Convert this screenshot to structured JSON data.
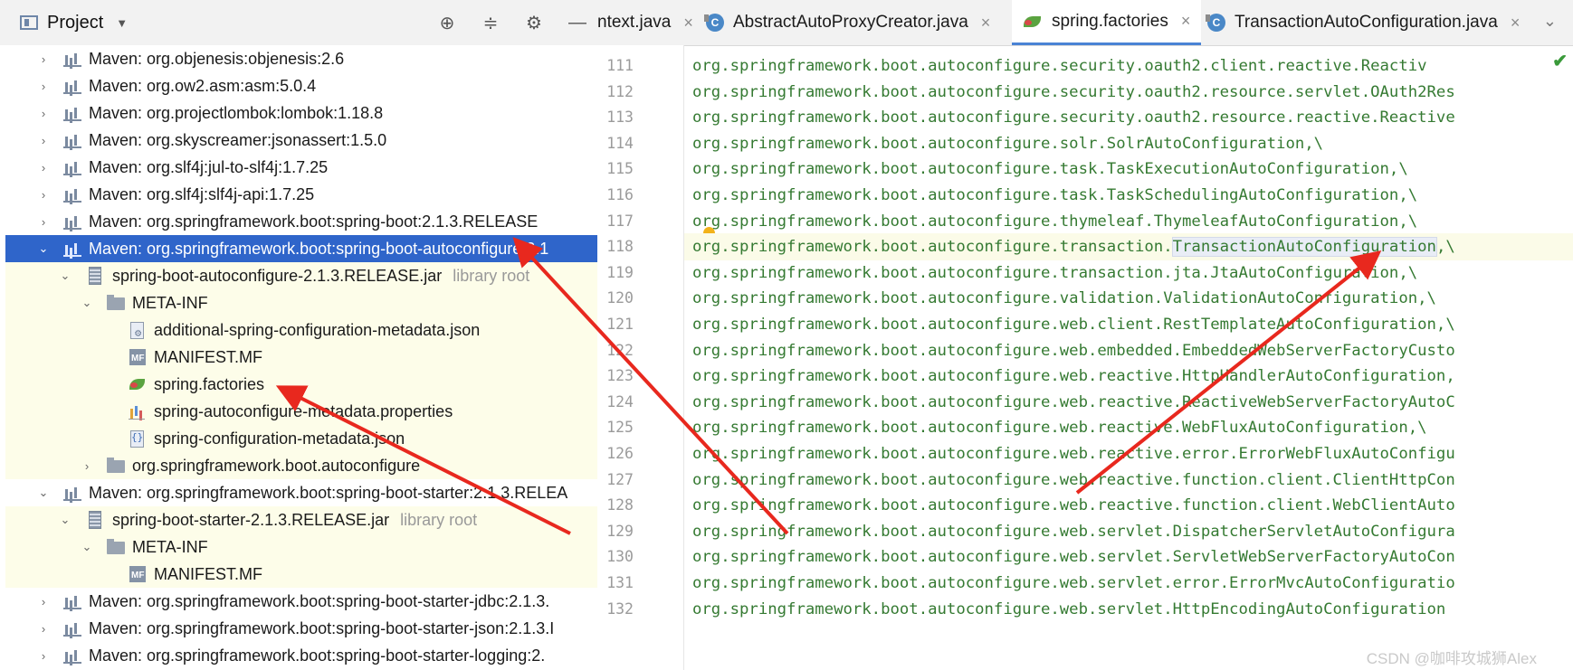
{
  "project": {
    "title": "Project",
    "tree": [
      {
        "label": "Maven: org.objenesis:objenesis:2.6",
        "arrow": "›",
        "icon": "lib"
      },
      {
        "label": "Maven: org.ow2.asm:asm:5.0.4",
        "arrow": "›",
        "icon": "lib"
      },
      {
        "label": "Maven: org.projectlombok:lombok:1.18.8",
        "arrow": "›",
        "icon": "lib"
      },
      {
        "label": "Maven: org.skyscreamer:jsonassert:1.5.0",
        "arrow": "›",
        "icon": "lib"
      },
      {
        "label": "Maven: org.slf4j:jul-to-slf4j:1.7.25",
        "arrow": "›",
        "icon": "lib"
      },
      {
        "label": "Maven: org.slf4j:slf4j-api:1.7.25",
        "arrow": "›",
        "icon": "lib"
      },
      {
        "label": "Maven: org.springframework.boot:spring-boot:2.1.3.RELEASE",
        "arrow": "›",
        "icon": "lib"
      },
      {
        "label": "Maven: org.springframework.boot:spring-boot-autoconfigure:2.1",
        "arrow": "⌄",
        "icon": "lib",
        "selected": true
      },
      {
        "label": "spring-boot-autoconfigure-2.1.3.RELEASE.jar",
        "arrow": "⌄",
        "icon": "jar",
        "suffix": "library root",
        "level": 1,
        "hl": true
      },
      {
        "label": "META-INF",
        "arrow": "⌄",
        "icon": "folder",
        "level": 2,
        "hl": true
      },
      {
        "label": "additional-spring-configuration-metadata.json",
        "icon": "json meta",
        "level": 3,
        "hl": true
      },
      {
        "label": "MANIFEST.MF",
        "icon": "mf",
        "level": 3,
        "hl": true
      },
      {
        "label": "spring.factories",
        "icon": "leaf",
        "level": 3,
        "hl": true
      },
      {
        "label": "spring-autoconfigure-metadata.properties",
        "icon": "props",
        "level": 3,
        "hl": true
      },
      {
        "label": "spring-configuration-metadata.json",
        "icon": "json",
        "level": 3,
        "hl": true
      },
      {
        "label": "org.springframework.boot.autoconfigure",
        "arrow": "›",
        "icon": "folder",
        "level": 2,
        "hl": true
      },
      {
        "label": "Maven: org.springframework.boot:spring-boot-starter:2.1.3.RELEA",
        "arrow": "⌄",
        "icon": "lib"
      },
      {
        "label": "spring-boot-starter-2.1.3.RELEASE.jar",
        "arrow": "⌄",
        "icon": "jar",
        "suffix": "library root",
        "level": 1,
        "hl": true
      },
      {
        "label": "META-INF",
        "arrow": "⌄",
        "icon": "folder",
        "level": 2,
        "hl": true
      },
      {
        "label": "MANIFEST.MF",
        "icon": "mf",
        "level": 3,
        "hl": true
      },
      {
        "label": "Maven: org.springframework.boot:spring-boot-starter-jdbc:2.1.3.",
        "arrow": "›",
        "icon": "lib"
      },
      {
        "label": "Maven: org.springframework.boot:spring-boot-starter-json:2.1.3.I",
        "arrow": "›",
        "icon": "lib"
      },
      {
        "label": "Maven: org.springframework.boot:spring-boot-starter-logging:2.",
        "arrow": "›",
        "icon": "lib"
      }
    ]
  },
  "tabs": [
    {
      "label": "ntext.java",
      "icon": "class-icon",
      "partial": true
    },
    {
      "label": "AbstractAutoProxyCreator.java",
      "icon": "class-icon"
    },
    {
      "label": "spring.factories",
      "icon": "spring-leaf-icon",
      "active": true
    },
    {
      "label": "TransactionAutoConfiguration.java",
      "icon": "class-icon"
    }
  ],
  "editor": {
    "lines": [
      {
        "n": "111",
        "t": "org.springframework.boot.autoconfigure.security.oauth2.client.reactive.Reactiv"
      },
      {
        "n": "112",
        "t": "org.springframework.boot.autoconfigure.security.oauth2.resource.servlet.OAuth2Res"
      },
      {
        "n": "113",
        "t": "org.springframework.boot.autoconfigure.security.oauth2.resource.reactive.Reactive"
      },
      {
        "n": "114",
        "t": "org.springframework.boot.autoconfigure.solr.SolrAutoConfiguration,\\"
      },
      {
        "n": "115",
        "t": "org.springframework.boot.autoconfigure.task.TaskExecutionAutoConfiguration,\\"
      },
      {
        "n": "116",
        "t": "org.springframework.boot.autoconfigure.task.TaskSchedulingAutoConfiguration,\\"
      },
      {
        "n": "117",
        "t": "org.springframework.boot.autoconfigure.thymeleaf.ThymeleafAutoConfiguration,\\"
      },
      {
        "n": "118",
        "pre": "org.springframework.boot.autoconfigure.transaction.",
        "word": "TransactionAutoConfiguration",
        "post": ",\\",
        "current": true
      },
      {
        "n": "119",
        "t": "org.springframework.boot.autoconfigure.transaction.jta.JtaAutoConfiguration,\\"
      },
      {
        "n": "120",
        "t": "org.springframework.boot.autoconfigure.validation.ValidationAutoConfiguration,\\"
      },
      {
        "n": "121",
        "t": "org.springframework.boot.autoconfigure.web.client.RestTemplateAutoConfiguration,\\"
      },
      {
        "n": "122",
        "t": "org.springframework.boot.autoconfigure.web.embedded.EmbeddedWebServerFactoryCusto"
      },
      {
        "n": "123",
        "t": "org.springframework.boot.autoconfigure.web.reactive.HttpHandlerAutoConfiguration,"
      },
      {
        "n": "124",
        "t": "org.springframework.boot.autoconfigure.web.reactive.ReactiveWebServerFactoryAutoC"
      },
      {
        "n": "125",
        "t": "org.springframework.boot.autoconfigure.web.reactive.WebFluxAutoConfiguration,\\"
      },
      {
        "n": "126",
        "t": "org.springframework.boot.autoconfigure.web.reactive.error.ErrorWebFluxAutoConfigu"
      },
      {
        "n": "127",
        "t": "org.springframework.boot.autoconfigure.web.reactive.function.client.ClientHttpCon"
      },
      {
        "n": "128",
        "t": "org.springframework.boot.autoconfigure.web.reactive.function.client.WebClientAuto"
      },
      {
        "n": "129",
        "t": "org.springframework.boot.autoconfigure.web.servlet.DispatcherServletAutoConfigura"
      },
      {
        "n": "130",
        "t": "org.springframework.boot.autoconfigure.web.servlet.ServletWebServerFactoryAutoCon"
      },
      {
        "n": "131",
        "t": "org.springframework.boot.autoconfigure.web.servlet.error.ErrorMvcAutoConfiguratio"
      },
      {
        "n": "132",
        "t": "org.springframework.boot.autoconfigure.web.servlet.HttpEncodingAutoConfiguration"
      }
    ]
  },
  "watermark": "CSDN @咖啡攻城狮Alex",
  "colors": {
    "selection": "#2f65ca",
    "code_text": "#357a32",
    "arrow": "#e8281e"
  }
}
